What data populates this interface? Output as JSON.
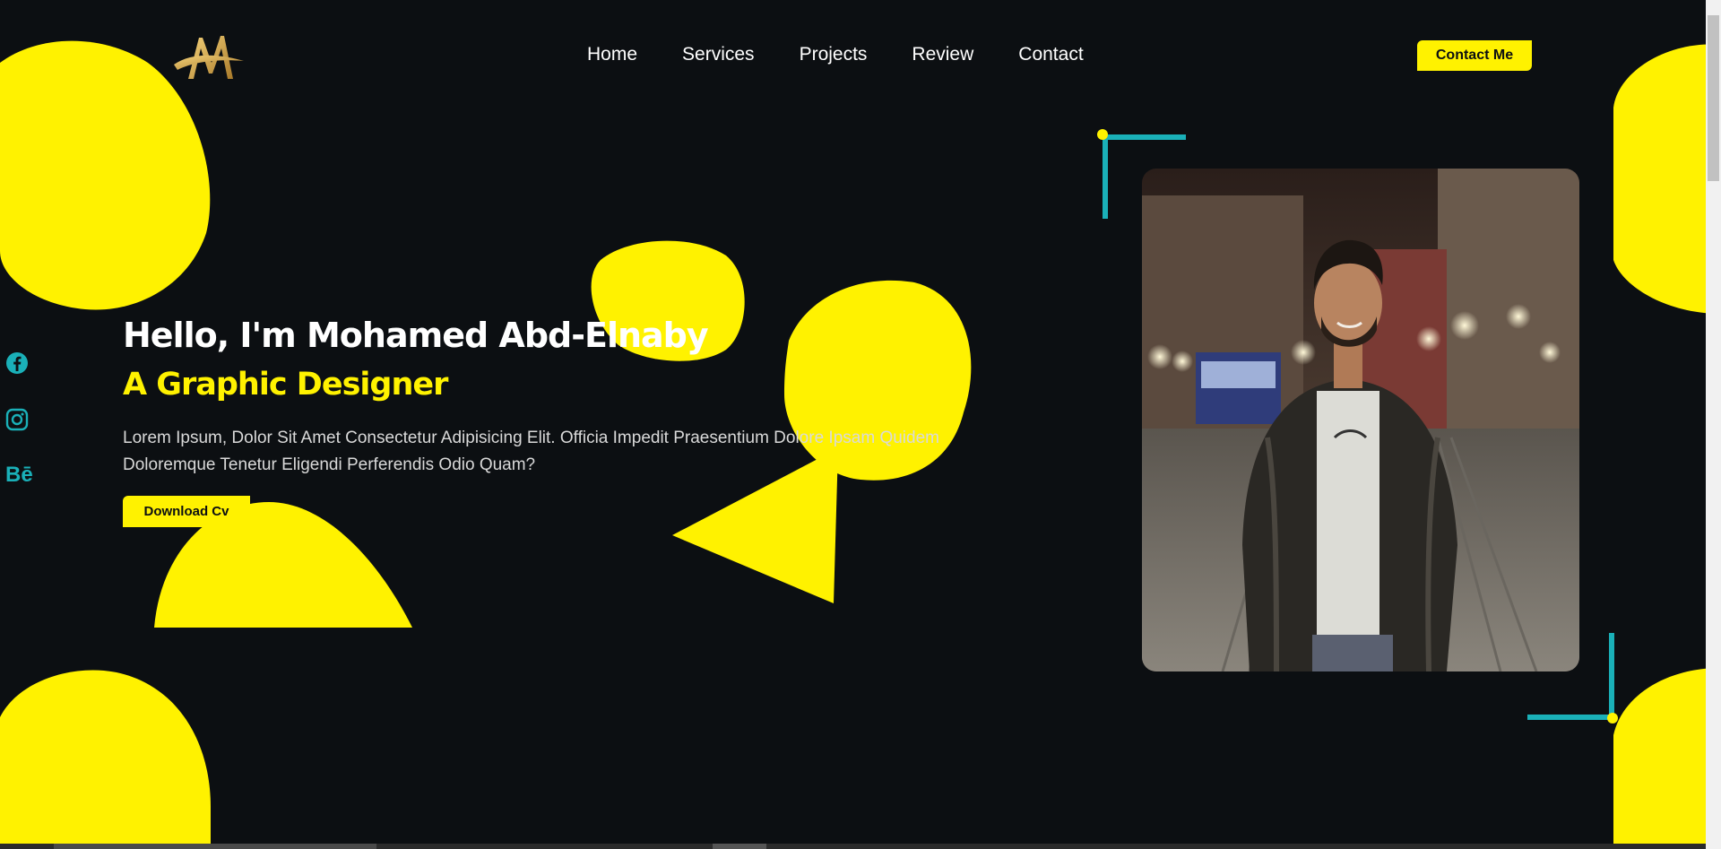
{
  "nav": {
    "items": [
      "Home",
      "Services",
      "Projects",
      "Review",
      "Contact"
    ],
    "contact_label": "Contact Me"
  },
  "logo": {
    "icon": "m-monogram-logo"
  },
  "hero": {
    "greeting": "Hello, I'm Mohamed Abd-Elnaby",
    "role": "A Graphic Designer",
    "description": "Lorem Ipsum, Dolor Sit Amet Consectetur Adipisicing Elit. Officia Impedit Praesentium Dolore Ipsam Quidem Doloremque Tenetur Eligendi Perferendis Odio Quam?",
    "download_label": "Download Cv"
  },
  "social": {
    "icons": [
      "facebook-icon",
      "instagram-icon",
      "behance-icon"
    ],
    "behance_text": "Bē"
  },
  "colors": {
    "background": "#0c0f12",
    "accent_yellow": "#fff200",
    "accent_teal": "#1ab0b8"
  }
}
